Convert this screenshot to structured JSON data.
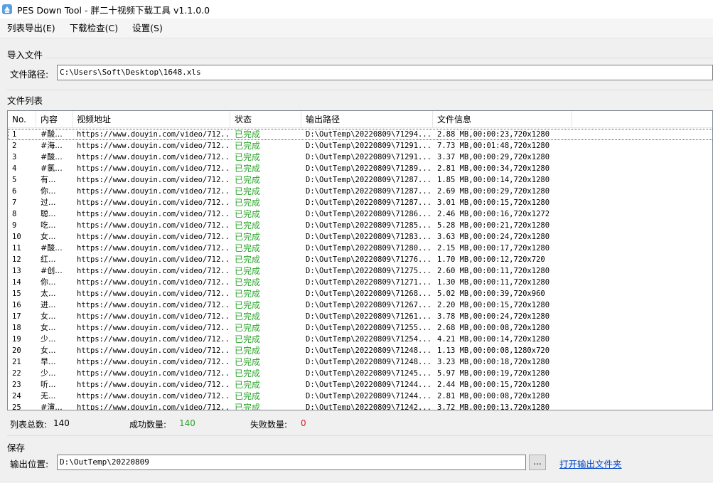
{
  "window": {
    "title": "PES Down Tool - 胖二十视频下载工具 v1.1.0.0",
    "icon": "app-icon"
  },
  "menu": [
    "列表导出(E)",
    "下载检查(C)",
    "设置(S)"
  ],
  "import_group": {
    "title": "导入文件",
    "path_label": "文件路径:",
    "path_value": "C:\\Users\\Soft\\Desktop\\1648.xls"
  },
  "list_group": {
    "title": "文件列表"
  },
  "columns": [
    "No.",
    "内容",
    "视频地址",
    "状态",
    "输出路径",
    "文件信息"
  ],
  "rows": [
    [
      "1",
      "#酸...",
      "https://www.douyin.com/video/712...",
      "已完成",
      "D:\\OutTemp\\20220809\\71294...",
      "2.88 MB,00:00:23,720x1280"
    ],
    [
      "2",
      "#海...",
      "https://www.douyin.com/video/712...",
      "已完成",
      "D:\\OutTemp\\20220809\\71291...",
      "7.73 MB,00:01:48,720x1280"
    ],
    [
      "3",
      "#酸...",
      "https://www.douyin.com/video/712...",
      "已完成",
      "D:\\OutTemp\\20220809\\71291...",
      "3.37 MB,00:00:29,720x1280"
    ],
    [
      "4",
      "#氯...",
      "https://www.douyin.com/video/712...",
      "已完成",
      "D:\\OutTemp\\20220809\\71289...",
      "2.81 MB,00:00:34,720x1280"
    ],
    [
      "5",
      "有...",
      "https://www.douyin.com/video/712...",
      "已完成",
      "D:\\OutTemp\\20220809\\71287...",
      "1.85 MB,00:00:14,720x1280"
    ],
    [
      "6",
      "你...",
      "https://www.douyin.com/video/712...",
      "已完成",
      "D:\\OutTemp\\20220809\\71287...",
      "2.69 MB,00:00:29,720x1280"
    ],
    [
      "7",
      "过...",
      "https://www.douyin.com/video/712...",
      "已完成",
      "D:\\OutTemp\\20220809\\71287...",
      "3.01 MB,00:00:15,720x1280"
    ],
    [
      "8",
      "聪...",
      "https://www.douyin.com/video/712...",
      "已完成",
      "D:\\OutTemp\\20220809\\71286...",
      "2.46 MB,00:00:16,720x1272"
    ],
    [
      "9",
      "吃...",
      "https://www.douyin.com/video/712...",
      "已完成",
      "D:\\OutTemp\\20220809\\71285...",
      "5.28 MB,00:00:21,720x1280"
    ],
    [
      "10",
      "女...",
      "https://www.douyin.com/video/712...",
      "已完成",
      "D:\\OutTemp\\20220809\\71283...",
      "3.63 MB,00:00:24,720x1280"
    ],
    [
      "11",
      "#酸...",
      "https://www.douyin.com/video/712...",
      "已完成",
      "D:\\OutTemp\\20220809\\71280...",
      "2.15 MB,00:00:17,720x1280"
    ],
    [
      "12",
      "红...",
      "https://www.douyin.com/video/712...",
      "已完成",
      "D:\\OutTemp\\20220809\\71276...",
      "1.70 MB,00:00:12,720x720"
    ],
    [
      "13",
      "#创...",
      "https://www.douyin.com/video/712...",
      "已完成",
      "D:\\OutTemp\\20220809\\71275...",
      "2.60 MB,00:00:11,720x1280"
    ],
    [
      "14",
      "你...",
      "https://www.douyin.com/video/712...",
      "已完成",
      "D:\\OutTemp\\20220809\\71271...",
      "1.30 MB,00:00:11,720x1280"
    ],
    [
      "15",
      "太...",
      "https://www.douyin.com/video/712...",
      "已完成",
      "D:\\OutTemp\\20220809\\71268...",
      "5.02 MB,00:00:39,720x960"
    ],
    [
      "16",
      "进...",
      "https://www.douyin.com/video/712...",
      "已完成",
      "D:\\OutTemp\\20220809\\71267...",
      "2.20 MB,00:00:15,720x1280"
    ],
    [
      "17",
      "女...",
      "https://www.douyin.com/video/712...",
      "已完成",
      "D:\\OutTemp\\20220809\\71261...",
      "3.78 MB,00:00:24,720x1280"
    ],
    [
      "18",
      "女...",
      "https://www.douyin.com/video/712...",
      "已完成",
      "D:\\OutTemp\\20220809\\71255...",
      "2.68 MB,00:00:08,720x1280"
    ],
    [
      "19",
      "少...",
      "https://www.douyin.com/video/712...",
      "已完成",
      "D:\\OutTemp\\20220809\\71254...",
      "4.21 MB,00:00:14,720x1280"
    ],
    [
      "20",
      "女...",
      "https://www.douyin.com/video/712...",
      "已完成",
      "D:\\OutTemp\\20220809\\71248...",
      "1.13 MB,00:00:08,1280x720"
    ],
    [
      "21",
      "早...",
      "https://www.douyin.com/video/712...",
      "已完成",
      "D:\\OutTemp\\20220809\\71248...",
      "3.23 MB,00:00:18,720x1280"
    ],
    [
      "22",
      "少...",
      "https://www.douyin.com/video/712...",
      "已完成",
      "D:\\OutTemp\\20220809\\71245...",
      "5.97 MB,00:00:19,720x1280"
    ],
    [
      "23",
      "听...",
      "https://www.douyin.com/video/712...",
      "已完成",
      "D:\\OutTemp\\20220809\\71244...",
      "2.44 MB,00:00:15,720x1280"
    ],
    [
      "24",
      "无...",
      "https://www.douyin.com/video/712...",
      "已完成",
      "D:\\OutTemp\\20220809\\71244...",
      "2.81 MB,00:00:08,720x1280"
    ],
    [
      "25",
      "#演...",
      "https://www.douyin.com/video/712...",
      "已完成",
      "D:\\OutTemp\\20220809\\71242...",
      "3.72 MB,00:00:13,720x1280"
    ]
  ],
  "summary": {
    "total_label": "列表总数:",
    "total": "140",
    "success_label": "成功数量:",
    "success": "140",
    "fail_label": "失败数量:",
    "fail": "0"
  },
  "save_group": {
    "title": "保存",
    "out_label": "输出位置:",
    "out_value": "D:\\OutTemp\\20220809",
    "browse_label": "...",
    "open_folder_label": "打开输出文件夹"
  },
  "colors": {
    "success": "#2aa42a",
    "fail": "#cc2222",
    "link": "#0044cc"
  }
}
